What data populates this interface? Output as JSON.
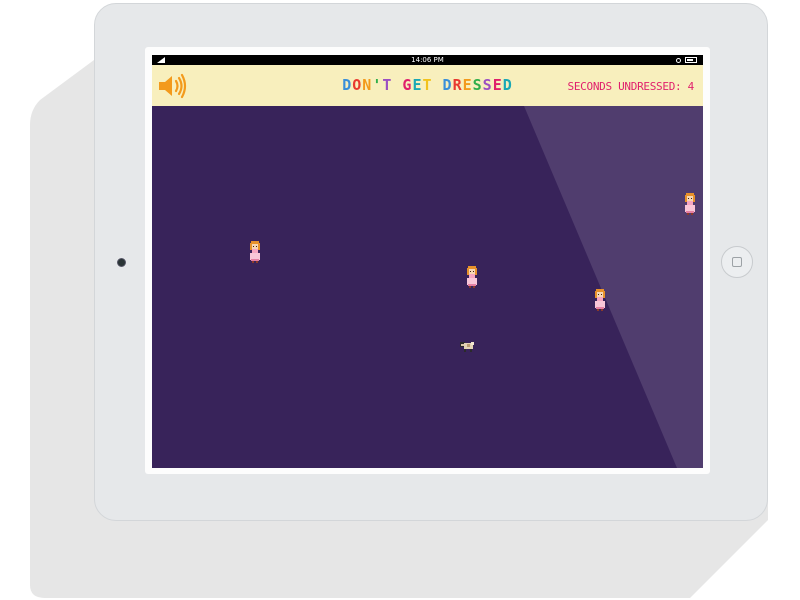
{
  "status_bar": {
    "time": "14:06 PM"
  },
  "game": {
    "title": "DON'T GET DRESSED",
    "title_colors": [
      "#3a8fd9",
      "#e8392f",
      "#f39a1c",
      "#2fae4a",
      "#9b4fc2",
      "#e01f6c",
      "#19a8b5",
      "#f2c21b"
    ],
    "timer_label": "SECONDS UNDRESSED:",
    "timer_value": "4",
    "sound_icon": "speaker-volume-icon",
    "accent_color": "#f39a1c",
    "timer_color": "#e01f6c",
    "header_bg": "#f8efbd",
    "playfield_bg": "#38235a"
  },
  "entities": {
    "dressers": [
      {
        "name": "dresser-girl-1",
        "icon": "girl-in-pink-dress-sprite"
      },
      {
        "name": "dresser-girl-2",
        "icon": "girl-in-pink-dress-sprite"
      },
      {
        "name": "dresser-girl-3",
        "icon": "girl-in-pink-dress-sprite"
      },
      {
        "name": "dresser-girl-4",
        "icon": "girl-in-pink-dress-sprite"
      }
    ],
    "player": {
      "icon": "naked-pug-sprite"
    }
  }
}
